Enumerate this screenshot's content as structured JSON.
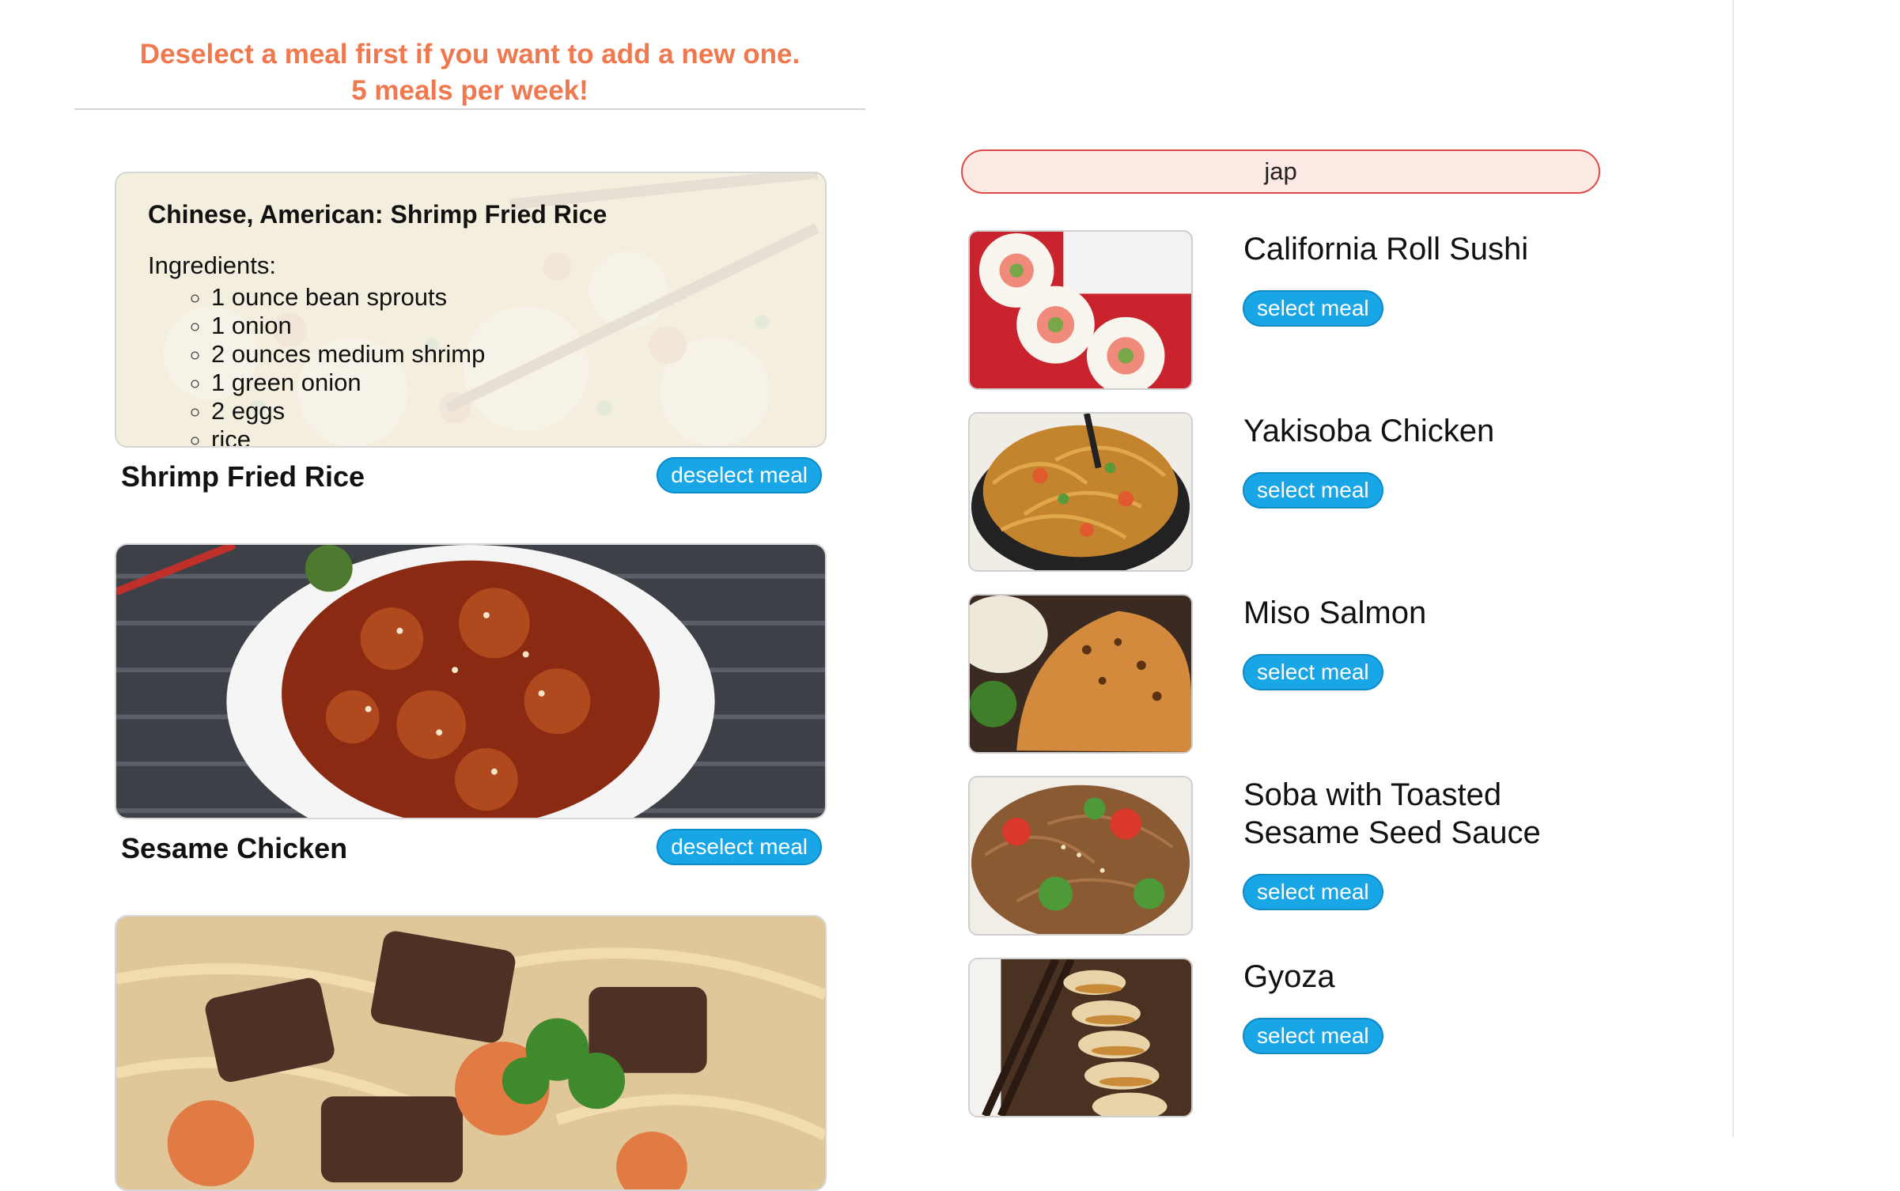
{
  "notice": {
    "line1": "Deselect a meal first if you want to add a new one.",
    "line2": "5 meals per week!"
  },
  "colors": {
    "accent": "#f0784e",
    "button": "#19a6e6",
    "search_border": "#dc4a47",
    "search_bg": "#fde9e4"
  },
  "selected_meals": [
    {
      "title": "Shrimp Fried Rice",
      "button_label": "deselect meal",
      "details": {
        "heading": "Chinese, American: Shrimp Fried Rice",
        "ingredients_label": "Ingredients:",
        "ingredients": [
          "1 ounce bean sprouts",
          "1 onion",
          "2 ounces medium shrimp",
          "1 green onion",
          "2 eggs",
          "rice"
        ]
      }
    },
    {
      "title": "Sesame Chicken",
      "button_label": "deselect meal"
    },
    {
      "title": "",
      "button_label": ""
    }
  ],
  "search": {
    "value": "jap"
  },
  "results": [
    {
      "title": "California Roll Sushi",
      "button_label": "select meal"
    },
    {
      "title": "Yakisoba Chicken",
      "button_label": "select meal"
    },
    {
      "title": "Miso Salmon",
      "button_label": "select meal"
    },
    {
      "title": "Soba with Toasted Sesame Seed Sauce",
      "button_label": "select meal"
    },
    {
      "title": "Gyoza",
      "button_label": "select meal"
    }
  ]
}
